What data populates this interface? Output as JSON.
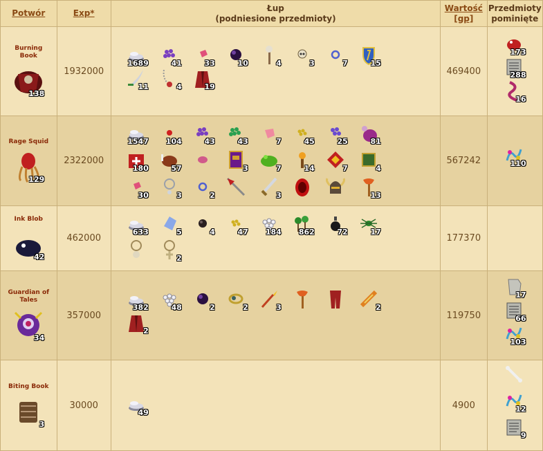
{
  "headers": {
    "monster": "Potwór",
    "exp": "Exp*",
    "loot_line1": "Łup",
    "loot_line2": "(podniesione przedmioty)",
    "value_line1": "Wartość",
    "value_line2": "[gp]",
    "skipped_line1": "Przedmioty",
    "skipped_line2": "pominięte"
  },
  "rows": [
    {
      "name_line1": "Burning",
      "name_line2": "Book",
      "kills": "138",
      "exp": "1932000",
      "value": "469400",
      "loot": [
        {
          "icon": "coins-icon",
          "count": "1689"
        },
        {
          "icon": "purple-gems-icon",
          "count": "41"
        },
        {
          "icon": "small-ruby-icon",
          "count": "33"
        },
        {
          "icon": "dark-orb-icon",
          "count": "10"
        },
        {
          "icon": "skull-staff-icon",
          "count": "4"
        },
        {
          "icon": "skull-icon",
          "count": "3"
        },
        {
          "icon": "ring-icon",
          "count": "7"
        },
        {
          "icon": "shield-icon",
          "count": "15"
        },
        {
          "icon": "scimitar-icon",
          "count": "11"
        },
        {
          "icon": "amulet-chain-icon",
          "count": "4"
        },
        {
          "icon": "red-robe-icon",
          "count": "19"
        }
      ],
      "skipped": [
        {
          "icon": "red-creature-icon",
          "count": "173"
        },
        {
          "icon": "scroll-icon",
          "count": "288"
        },
        {
          "icon": "tentacle-icon",
          "count": "16"
        }
      ]
    },
    {
      "name_line1": "Rage Squid",
      "name_line2": "",
      "kills": "129",
      "exp": "2322000",
      "value": "567242",
      "loot": [
        {
          "icon": "coins-icon",
          "count": "1547"
        },
        {
          "icon": "red-berry-icon",
          "count": "104"
        },
        {
          "icon": "purple-gems-icon",
          "count": "43"
        },
        {
          "icon": "green-gems-icon",
          "count": "43"
        },
        {
          "icon": "pink-crystal-icon",
          "count": "7"
        },
        {
          "icon": "gold-nuggets-icon",
          "count": "45"
        },
        {
          "icon": "violet-gems-icon",
          "count": "25"
        },
        {
          "icon": "purple-pouch-icon",
          "count": "81"
        },
        {
          "icon": "medkit-icon",
          "count": "180"
        },
        {
          "icon": "meat-icon",
          "count": "57"
        },
        {
          "icon": "pink-brain-icon",
          "count": ""
        },
        {
          "icon": "spellbook-icon",
          "count": "3"
        },
        {
          "icon": "green-frog-icon",
          "count": "7"
        },
        {
          "icon": "torch-icon",
          "count": "14"
        },
        {
          "icon": "red-gem-cluster-icon",
          "count": "7"
        },
        {
          "icon": "green-cube-icon",
          "count": "4"
        },
        {
          "icon": "small-ruby-icon",
          "count": "30"
        },
        {
          "icon": "silver-amulet-icon",
          "count": "3"
        },
        {
          "icon": "ring-icon",
          "count": "2"
        },
        {
          "icon": "spear-icon",
          "count": ""
        },
        {
          "icon": "sword-icon",
          "count": "3"
        },
        {
          "icon": "red-mask-icon",
          "count": ""
        },
        {
          "icon": "horned-helmet-icon",
          "count": ""
        },
        {
          "icon": "axe-icon",
          "count": "13"
        }
      ],
      "skipped": [
        {
          "icon": "colorful-worm-icon",
          "count": "110"
        }
      ]
    },
    {
      "name_line1": "Ink Blob",
      "name_line2": "",
      "kills": "42",
      "exp": "462000",
      "value": "177370",
      "loot": [
        {
          "icon": "coins-icon",
          "count": "633"
        },
        {
          "icon": "blue-crystal-icon",
          "count": "5"
        },
        {
          "icon": "black-pearl-icon",
          "count": "4"
        },
        {
          "icon": "gold-nuggets-icon",
          "count": "47"
        },
        {
          "icon": "white-pearls-icon",
          "count": "184"
        },
        {
          "icon": "green-trees-icon",
          "count": "862"
        },
        {
          "icon": "ink-flask-icon",
          "count": "72"
        },
        {
          "icon": "green-spider-icon",
          "count": "17"
        },
        {
          "icon": "skull-amulet-icon",
          "count": ""
        },
        {
          "icon": "cross-amulet-icon",
          "count": "2"
        }
      ],
      "skipped": []
    },
    {
      "name_line1": "Guardian of",
      "name_line2": "Tales",
      "kills": "34",
      "exp": "357000",
      "value": "119750",
      "loot": [
        {
          "icon": "coins-icon",
          "count": "382"
        },
        {
          "icon": "white-pearls-icon",
          "count": "48"
        },
        {
          "icon": "dark-orb-icon",
          "count": "2"
        },
        {
          "icon": "gold-ring-icon",
          "count": "2"
        },
        {
          "icon": "fire-wand-icon",
          "count": "3"
        },
        {
          "icon": "axe-icon",
          "count": ""
        },
        {
          "icon": "red-legs-icon",
          "count": ""
        },
        {
          "icon": "fire-sword-icon",
          "count": "2"
        },
        {
          "icon": "red-robe-icon",
          "count": "2"
        }
      ],
      "skipped": [
        {
          "icon": "paper-icon",
          "count": "17"
        },
        {
          "icon": "scroll-icon",
          "count": "66"
        },
        {
          "icon": "colorful-worm-icon",
          "count": "103"
        }
      ]
    },
    {
      "name_line1": "Biting Book",
      "name_line2": "",
      "kills": "3",
      "exp": "30000",
      "value": "4900",
      "loot": [
        {
          "icon": "coins-icon",
          "count": "49"
        }
      ],
      "skipped": [
        {
          "icon": "bone-icon",
          "count": ""
        },
        {
          "icon": "colorful-worm-icon",
          "count": "12"
        },
        {
          "icon": "scroll-icon",
          "count": "9"
        }
      ]
    }
  ]
}
